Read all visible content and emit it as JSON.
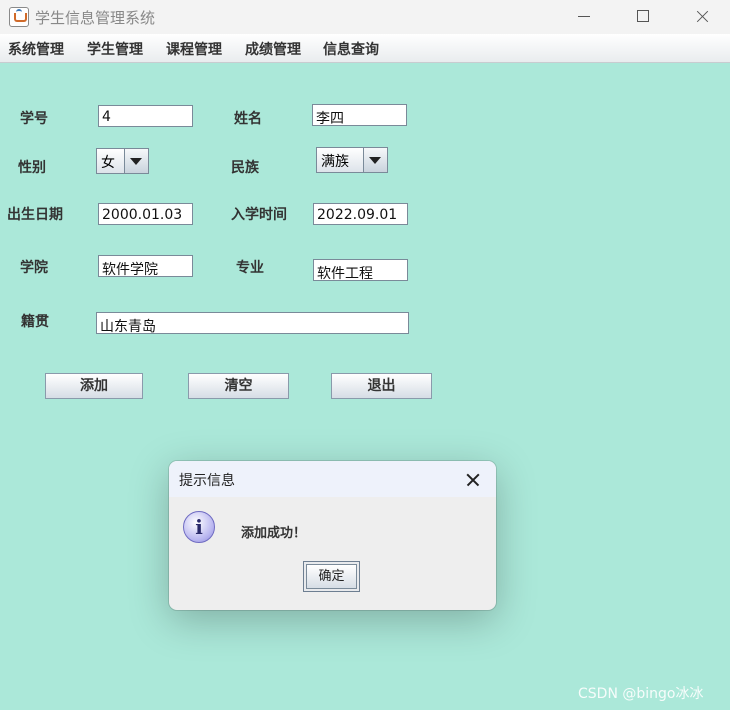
{
  "window": {
    "title": "学生信息管理系统"
  },
  "menu": [
    "系统管理",
    "学生管理",
    "课程管理",
    "成绩管理",
    "信息查询"
  ],
  "form": {
    "id_label": "学号",
    "id_value": "4",
    "name_label": "姓名",
    "name_value": "李四",
    "gender_label": "性别",
    "gender_value": "女",
    "ethnicity_label": "民族",
    "ethnicity_value": "满族",
    "birth_label": "出生日期",
    "birth_value": "2000.01.03",
    "enroll_label": "入学时间",
    "enroll_value": "2022.09.01",
    "college_label": "学院",
    "college_value": "软件学院",
    "major_label": "专业",
    "major_value": "软件工程",
    "hometown_label": "籍贯",
    "hometown_value": "山东青岛"
  },
  "buttons": {
    "add": "添加",
    "clear": "清空",
    "exit": "退出"
  },
  "dialog": {
    "title": "提示信息",
    "message": "添加成功！",
    "ok": "确定",
    "icon": "info-icon"
  },
  "watermark": "CSDN @bingo冰冰"
}
